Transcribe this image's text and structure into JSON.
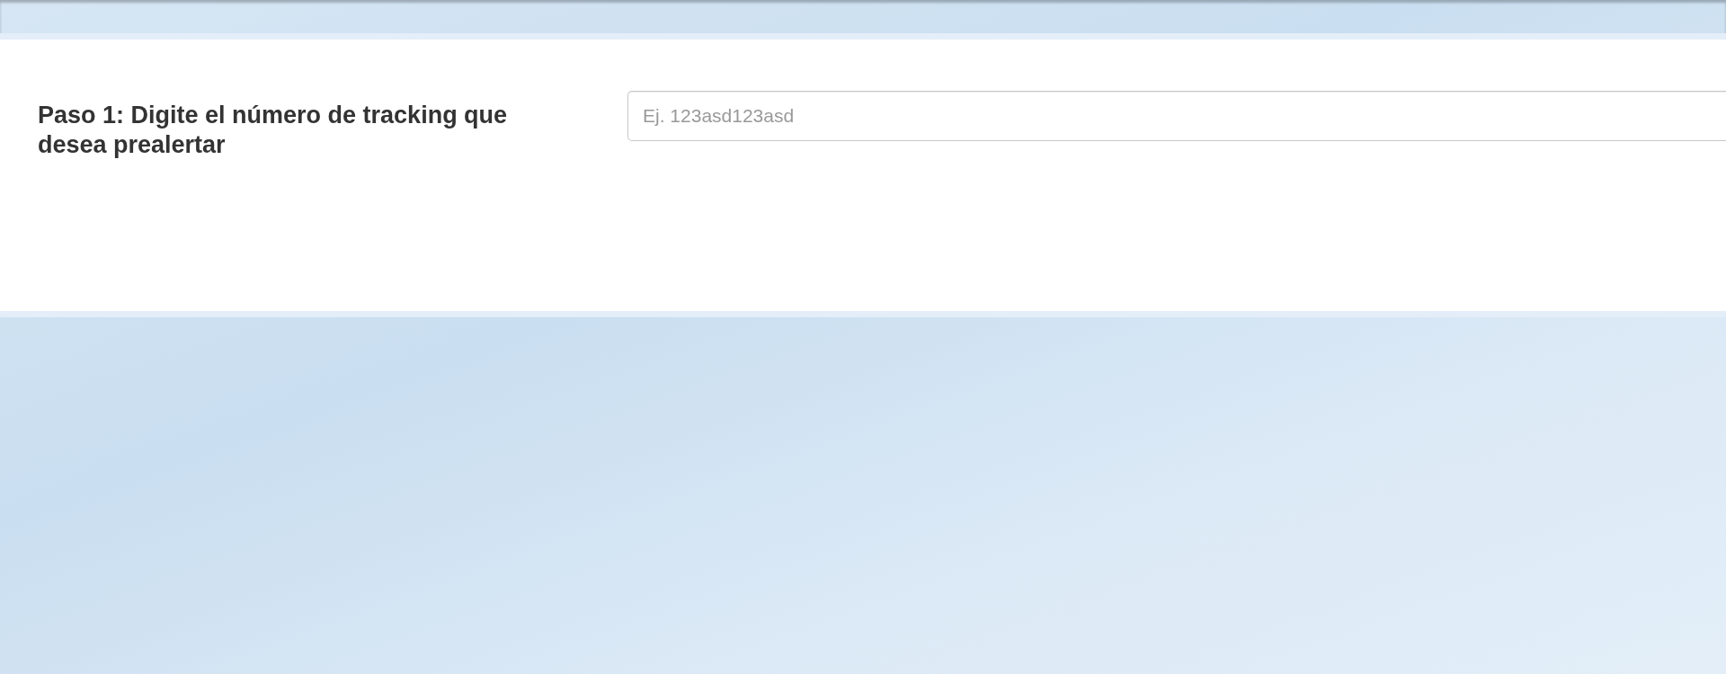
{
  "form": {
    "label": "Paso 1: Digite el número de tracking que desea prealertar",
    "tracking_field": {
      "placeholder": "Ej. 123asd123asd"
    }
  }
}
